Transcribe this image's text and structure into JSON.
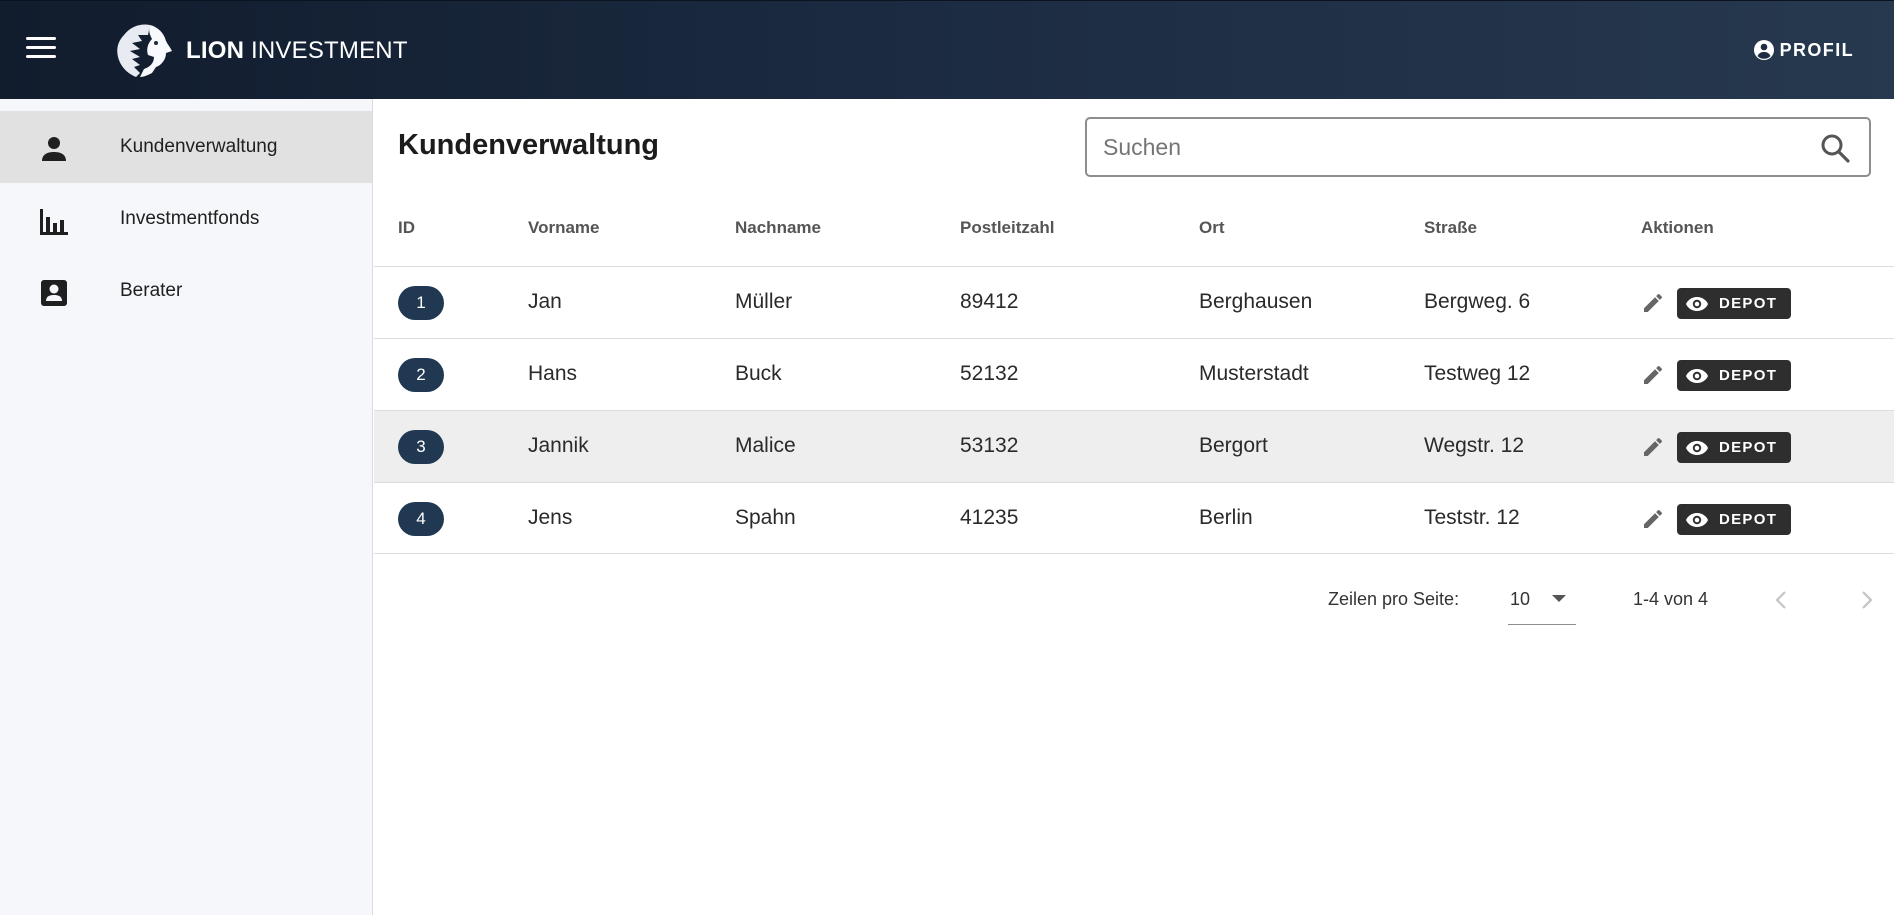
{
  "header": {
    "brand_bold": "LION",
    "brand_rest": "INVESTMENT",
    "profile_label": "PROFIL",
    "colors": {
      "start": "#111c2d",
      "end": "#27394f"
    }
  },
  "sidebar": {
    "items": [
      {
        "label": "Kundenverwaltung",
        "icon": "person-icon",
        "active": true
      },
      {
        "label": "Investmentfonds",
        "icon": "bar-chart-icon",
        "active": false
      },
      {
        "label": "Berater",
        "icon": "contact-card-icon",
        "active": false
      }
    ]
  },
  "main": {
    "title": "Kundenverwaltung",
    "search": {
      "placeholder": "Suchen",
      "value": ""
    },
    "table": {
      "columns": [
        "ID",
        "Vorname",
        "Nachname",
        "Postleitzahl",
        "Ort",
        "Straße",
        "Aktionen"
      ],
      "rows": [
        {
          "id": "1",
          "vorname": "Jan",
          "nachname": "Müller",
          "plz": "89412",
          "ort": "Berghausen",
          "strasse": "Bergweg. 6",
          "action": "DEPOT"
        },
        {
          "id": "2",
          "vorname": "Hans",
          "nachname": "Buck",
          "plz": "52132",
          "ort": "Musterstadt",
          "strasse": "Testweg 12",
          "action": "DEPOT"
        },
        {
          "id": "3",
          "vorname": "Jannik",
          "nachname": "Malice",
          "plz": "53132",
          "ort": "Bergort",
          "strasse": "Wegstr. 12",
          "action": "DEPOT"
        },
        {
          "id": "4",
          "vorname": "Jens",
          "nachname": "Spahn",
          "plz": "41235",
          "ort": "Berlin",
          "strasse": "Teststr. 12",
          "action": "DEPOT"
        }
      ]
    },
    "pagination": {
      "rows_label": "Zeilen pro Seite:",
      "rows_value": "10",
      "range": "1-4 von 4"
    }
  },
  "colors": {
    "badge": "#213852",
    "depot_button": "#2e2e2e",
    "highlight_row": "#eeeeee"
  }
}
